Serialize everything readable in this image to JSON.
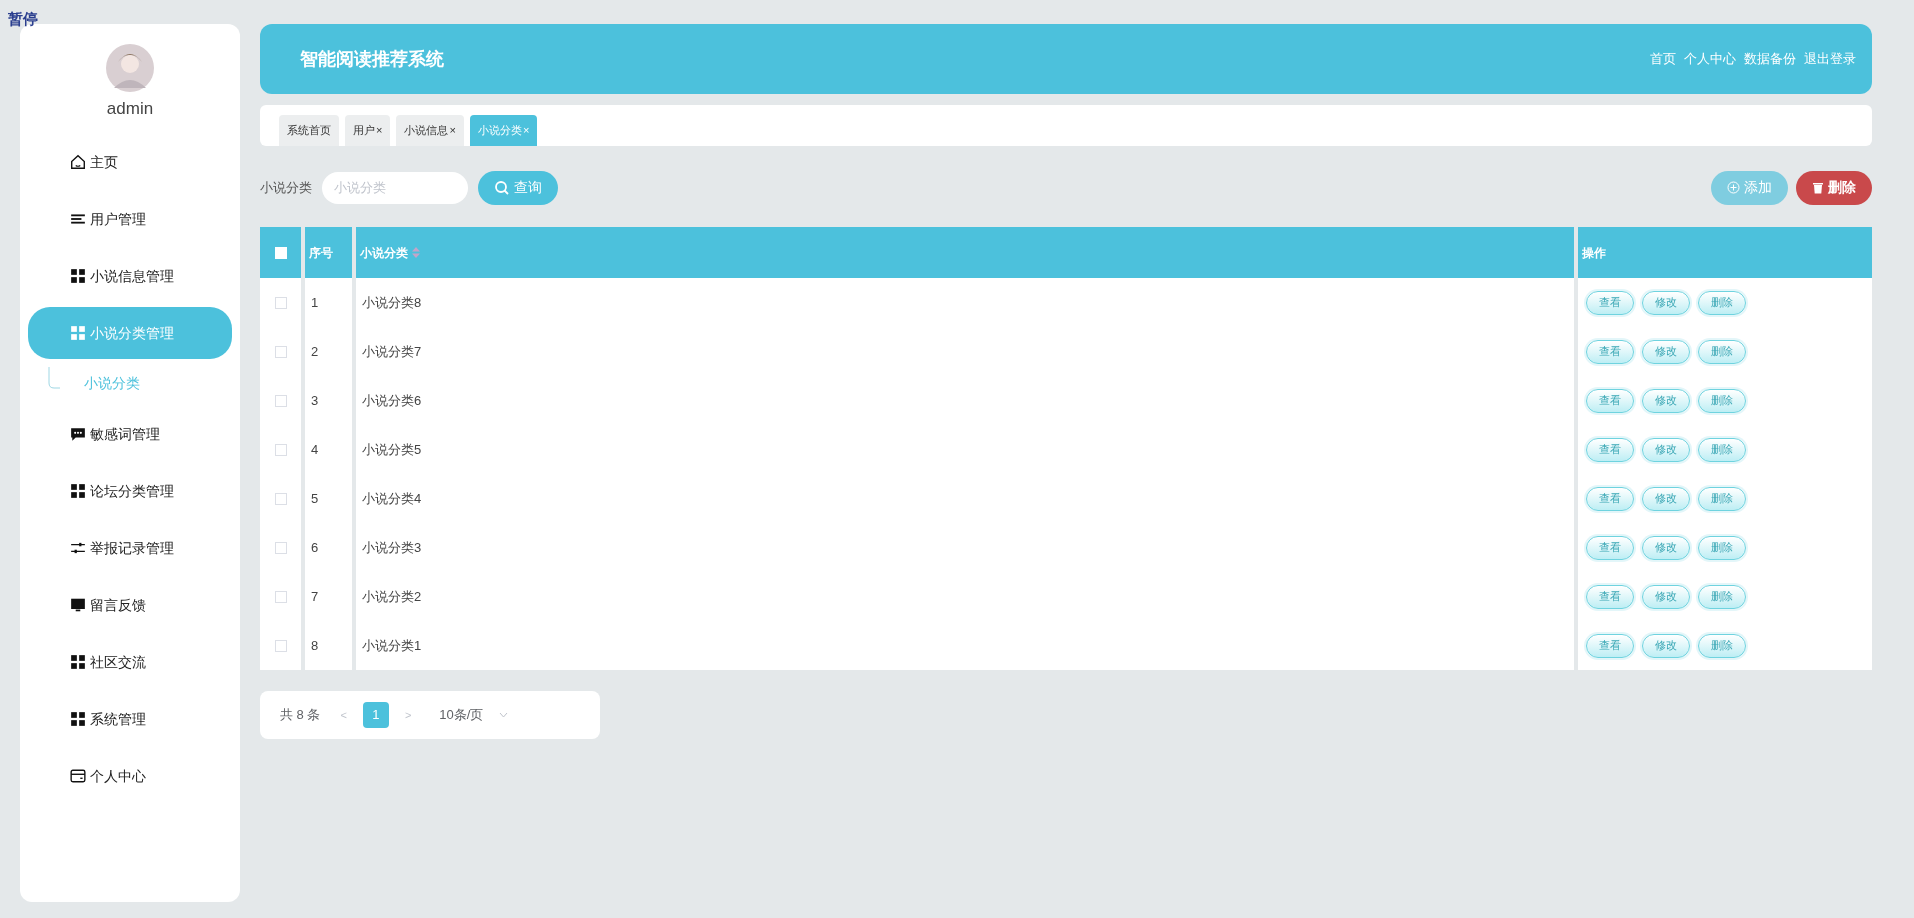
{
  "overlay_label": "暂停",
  "sidebar": {
    "username": "admin",
    "items": [
      {
        "label": "主页",
        "kind": "home",
        "selected": false
      },
      {
        "label": "用户管理",
        "kind": "lines",
        "selected": false
      },
      {
        "label": "小说信息管理",
        "kind": "grid",
        "selected": false
      },
      {
        "label": "小说分类管理",
        "kind": "grid",
        "selected": true,
        "expanded": true,
        "children": [
          {
            "label": "小说分类",
            "selected": true
          }
        ]
      },
      {
        "label": "敏感词管理",
        "kind": "chat",
        "selected": false
      },
      {
        "label": "论坛分类管理",
        "kind": "grid",
        "selected": false
      },
      {
        "label": "举报记录管理",
        "kind": "sliders",
        "selected": false
      },
      {
        "label": "留言反馈",
        "kind": "monitor",
        "selected": false
      },
      {
        "label": "社区交流",
        "kind": "grid",
        "selected": false
      },
      {
        "label": "系统管理",
        "kind": "grid",
        "selected": false
      },
      {
        "label": "个人中心",
        "kind": "card",
        "selected": false
      }
    ]
  },
  "header": {
    "title": "智能阅读推荐系统",
    "links": [
      "首页",
      "个人中心",
      "数据备份",
      "退出登录"
    ]
  },
  "tabs": [
    {
      "label": "系统首页",
      "selected": false
    },
    {
      "label": "用户",
      "close": "×",
      "selected": false
    },
    {
      "label": "小说信息",
      "close": "×",
      "selected": false
    },
    {
      "label": "小说分类",
      "close": "×",
      "selected": true
    }
  ],
  "search": {
    "label": "小说分类",
    "placeholder": "小说分类",
    "button": "查询"
  },
  "toolbar": [
    {
      "label": "添加",
      "kind": "add"
    },
    {
      "label": "删除",
      "kind": "delete"
    }
  ],
  "table": {
    "header_checked": false,
    "columns": [
      "序号",
      "小说分类",
      "操作"
    ],
    "rows": [
      {
        "checked": false,
        "index": "1",
        "name": "小说分类8",
        "actions": [
          "查看",
          "修改",
          "删除"
        ]
      },
      {
        "checked": false,
        "index": "2",
        "name": "小说分类7",
        "actions": [
          "查看",
          "修改",
          "删除"
        ]
      },
      {
        "checked": false,
        "index": "3",
        "name": "小说分类6",
        "actions": [
          "查看",
          "修改",
          "删除"
        ]
      },
      {
        "checked": false,
        "index": "4",
        "name": "小说分类5",
        "actions": [
          "查看",
          "修改",
          "删除"
        ]
      },
      {
        "checked": false,
        "index": "5",
        "name": "小说分类4",
        "actions": [
          "查看",
          "修改",
          "删除"
        ]
      },
      {
        "checked": false,
        "index": "6",
        "name": "小说分类3",
        "actions": [
          "查看",
          "修改",
          "删除"
        ]
      },
      {
        "checked": false,
        "index": "7",
        "name": "小说分类2",
        "actions": [
          "查看",
          "修改",
          "删除"
        ]
      },
      {
        "checked": false,
        "index": "8",
        "name": "小说分类1",
        "actions": [
          "查看",
          "修改",
          "删除"
        ]
      }
    ]
  },
  "pagination": {
    "total": "共 8 条",
    "prev": "<",
    "pages": [
      {
        "label": "1",
        "selected": true
      }
    ],
    "next": ">",
    "page_size": "10条/页"
  }
}
